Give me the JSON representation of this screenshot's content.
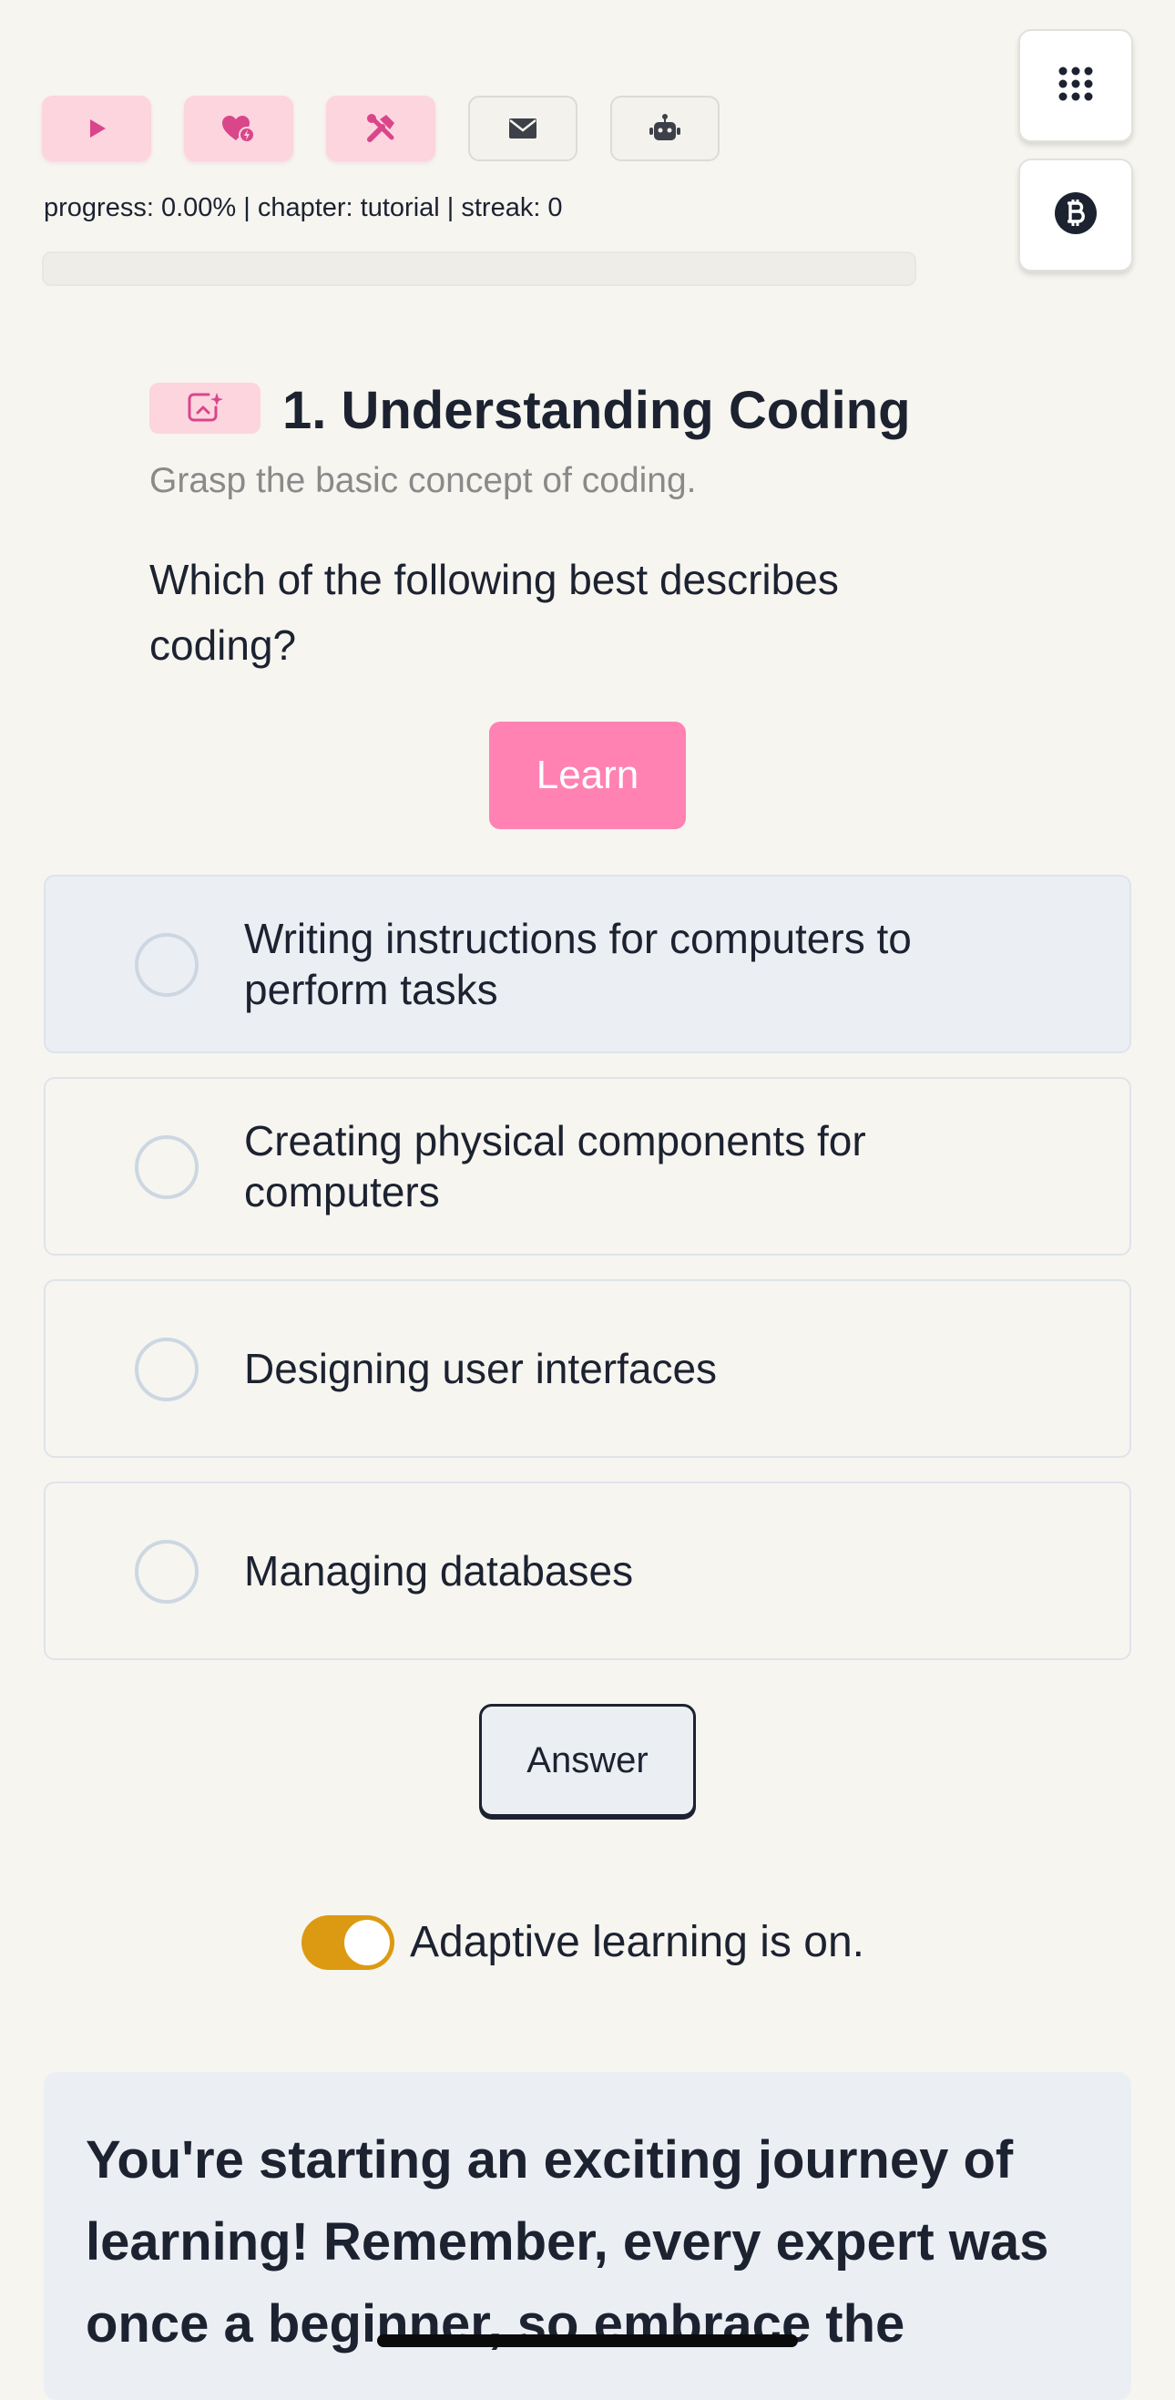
{
  "toolbar": {
    "buttons": [
      {
        "name": "play",
        "icon": "play-icon"
      },
      {
        "name": "favorites",
        "icon": "heart-bolt-icon"
      },
      {
        "name": "tools",
        "icon": "tools-icon"
      },
      {
        "name": "mail",
        "icon": "mail-icon"
      },
      {
        "name": "assistant",
        "icon": "robot-icon"
      }
    ],
    "status_text": "progress: 0.00% | chapter: tutorial | streak: 0",
    "progress_fraction": 0.0
  },
  "side": {
    "menu_icon": "grid-menu-icon",
    "coin_icon": "bitcoin-icon"
  },
  "lesson": {
    "badge_icon": "sparkle-image-icon",
    "title": "1. Understanding Coding",
    "subtitle": "Grasp the basic concept of coding.",
    "question": "Which of the following best describes coding?",
    "learn_label": "Learn"
  },
  "options": [
    {
      "label": "Writing instructions for computers to perform tasks",
      "selected": true
    },
    {
      "label": "Creating physical components for computers",
      "selected": false
    },
    {
      "label": "Designing user interfaces",
      "selected": false
    },
    {
      "label": "Managing databases",
      "selected": false
    }
  ],
  "answer_label": "Answer",
  "adaptive": {
    "enabled": true,
    "label": "Adaptive learning is on."
  },
  "message": {
    "text": "You're starting an exciting journey of learning! Remember, every expert was once a beginner, so embrace the"
  },
  "colors": {
    "background": "#f6f5f0",
    "accent_pink": "#ff82b2",
    "pink_soft": "#fcd5df",
    "toggle_on": "#dc9a12",
    "text": "#1c2230"
  }
}
